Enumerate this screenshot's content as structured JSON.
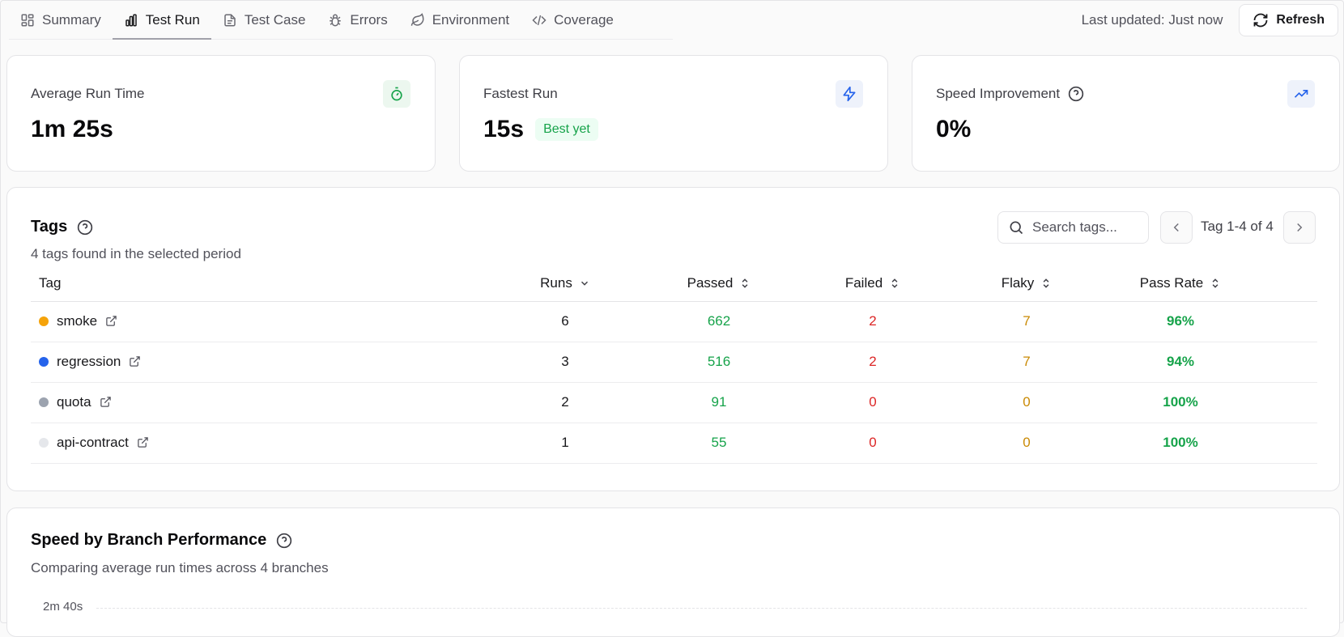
{
  "nav": {
    "tabs": [
      {
        "label": "Summary",
        "icon": "layout-dashboard-icon"
      },
      {
        "label": "Test Run",
        "icon": "bar-chart-icon",
        "active": true
      },
      {
        "label": "Test Case",
        "icon": "file-text-icon"
      },
      {
        "label": "Errors",
        "icon": "bug-icon"
      },
      {
        "label": "Environment",
        "icon": "leaf-icon"
      },
      {
        "label": "Coverage",
        "icon": "code-icon"
      }
    ],
    "last_updated": "Last updated: Just now",
    "refresh_label": "Refresh"
  },
  "stats": {
    "avg_label": "Average Run Time",
    "avg_value": "1m 25s",
    "fastest_label": "Fastest Run",
    "fastest_value": "15s",
    "fastest_badge": "Best yet",
    "speed_label": "Speed Improvement",
    "speed_value": "0%"
  },
  "tags": {
    "title": "Tags",
    "subtitle": "4 tags found in the selected period",
    "search_placeholder": "Search tags...",
    "pager_text": "Tag 1-4 of 4",
    "columns": {
      "tag": "Tag",
      "runs": "Runs",
      "passed": "Passed",
      "failed": "Failed",
      "flaky": "Flaky",
      "pass_rate": "Pass Rate"
    },
    "rows": [
      {
        "name": "smoke",
        "color": "#f5a30a",
        "runs": "6",
        "passed": "662",
        "failed": "2",
        "flaky": "7",
        "pass_rate": "96%"
      },
      {
        "name": "regression",
        "color": "#2563eb",
        "runs": "3",
        "passed": "516",
        "failed": "2",
        "flaky": "7",
        "pass_rate": "94%"
      },
      {
        "name": "quota",
        "color": "#9ca3af",
        "runs": "2",
        "passed": "91",
        "failed": "0",
        "flaky": "0",
        "pass_rate": "100%"
      },
      {
        "name": "api-contract",
        "color": "#e5e7eb",
        "runs": "1",
        "passed": "55",
        "failed": "0",
        "flaky": "0",
        "pass_rate": "100%"
      }
    ]
  },
  "branch": {
    "title": "Speed by Branch Performance",
    "subtitle": "Comparing average run times across 4 branches",
    "y_tick_top": "2m 40s"
  },
  "colors": {
    "green": "#16a34a",
    "red": "#dc2626",
    "amber": "#ca8a04",
    "blue": "#2563eb"
  }
}
